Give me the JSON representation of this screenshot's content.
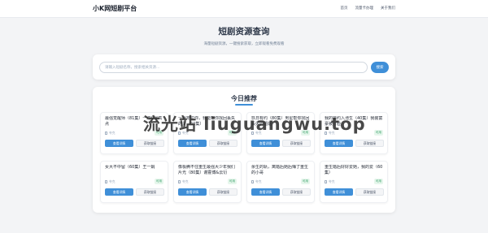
{
  "header": {
    "brand": "小K网短剧平台",
    "nav": [
      "首页",
      "流量卡办理",
      "关于我们"
    ]
  },
  "hero": {
    "title": "短剧资源查询",
    "subtitle": "海量短剧资源，一键搜索获取，立即观看免费观看"
  },
  "search": {
    "placeholder": "请输入短剧名称，搜索相关资源...",
    "button": "搜索"
  },
  "recommend": {
    "title": "今日推荐",
    "cards": [
      {
        "title": "最强觉醒师（81集）一遍&最高点",
        "source": "夸克",
        "badge": "可用",
        "view": "查看详情",
        "copy": "获取链接"
      },
      {
        "title": "一世宠爱你，我能帮你找回丢失的爱（60集）",
        "source": "夸克",
        "badge": "可用",
        "view": "查看详情",
        "copy": "获取链接"
      },
      {
        "title": "玖日有约（80集）男星帮你找回丢失的婚姻",
        "source": "夸克",
        "badge": "可用",
        "view": "查看详情",
        "copy": "获取链接"
      },
      {
        "title": "我的婚约入池生（40集）我装富豪被打脸",
        "source": "夸克",
        "badge": "可用",
        "view": "查看详情",
        "copy": "获取链接"
      },
      {
        "title": "女大不中留（60集）王一娟",
        "source": "夸克",
        "badge": "可用",
        "view": "查看详情",
        "copy": "获取链接"
      },
      {
        "title": "像极腾不住重生最强大少年我们片光（80集）谢霍博&云衍",
        "source": "夸克",
        "badge": "可用",
        "view": "查看详情",
        "copy": "获取链接"
      },
      {
        "title": "余生的轨，离婚后她后悔了重生的小哥",
        "source": "夸克",
        "badge": "可用",
        "view": "查看详情",
        "copy": "获取链接"
      },
      {
        "title": "重生婚后好好爱她，我的爱（60集）",
        "source": "夸克",
        "badge": "可用",
        "view": "查看详情",
        "copy": "获取链接"
      }
    ]
  },
  "watermark": "流光站 liuguangwu.top",
  "colors": {
    "accent": "#3f8fd8",
    "badge_green": "#38a169",
    "background": "#f3f4f6"
  }
}
